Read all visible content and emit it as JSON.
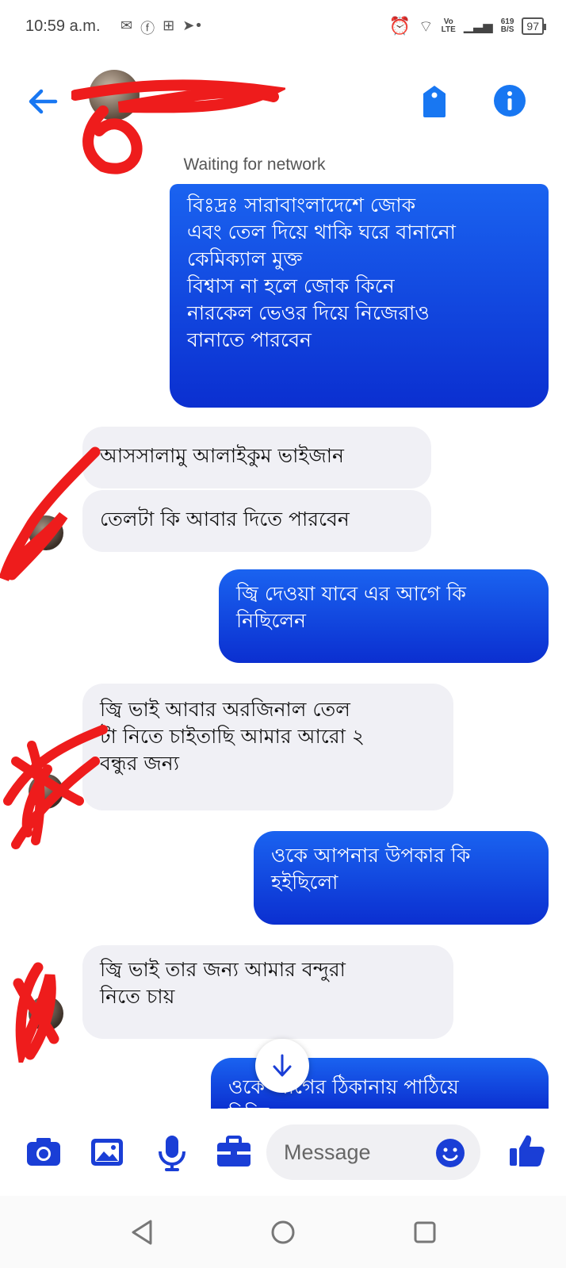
{
  "status_bar": {
    "time": "10:59 a.m.",
    "network_label_top": "Vo",
    "network_label_bottom": "LTE",
    "speed_top": "619",
    "speed_bottom": "B/S",
    "battery": "97"
  },
  "header": {
    "network_status": "Waiting for network"
  },
  "messages": [
    {
      "from": "me",
      "text": "বিঃদ্রঃ সারাবাংলাদেশে  জোক\nএবং তেল দিয়ে থাকি ঘরে বানানো\nকেমিক্যাল মুক্ত\nবিশ্বাস না হলে জোক কিনে\nনারকেল ভেওর দিয়ে নিজেরাও\nবানাতে পারবেন"
    },
    {
      "from": "them",
      "text": "আসসালামু আলাইকুম ভাইজান"
    },
    {
      "from": "them",
      "text": "তেলটা কি আবার দিতে পারবেন"
    },
    {
      "from": "me",
      "text": "জ্বি দেওয়া যাবে এর আগে কি\nনিছিলেন"
    },
    {
      "from": "them",
      "text": "জ্বি ভাই আবার অরজিনাল তেল\nটা নিতে চাইতাছি আমার আরো ২\nবন্ধুর জন্য"
    },
    {
      "from": "me",
      "text": "ওকে আপনার উপকার কি\nহইছিলো"
    },
    {
      "from": "them",
      "text": "জ্বি ভাই তার জন্য আমার বন্দুরা\nনিতে চায়"
    },
    {
      "from": "me",
      "text": "ওকে আগের  ঠিকানায় পাঠিয়ে\nদিচ্ছি"
    }
  ],
  "composer": {
    "placeholder": "Message"
  },
  "colors": {
    "accent": "#1877f2",
    "outgoing_bubble_top": "#1a63f0",
    "outgoing_bubble_bottom": "#0b2fd0",
    "incoming_bubble": "#f0f0f5",
    "redaction_scribble": "#ee1c1c"
  },
  "icons": {
    "back": "arrow-left-icon",
    "tag": "tag-icon",
    "info": "info-icon",
    "camera": "camera-icon",
    "gallery": "image-icon",
    "mic": "microphone-icon",
    "toolbox": "briefcase-icon",
    "emoji": "smiley-icon",
    "like": "thumbs-up-icon",
    "scroll_down": "arrow-down-icon"
  }
}
